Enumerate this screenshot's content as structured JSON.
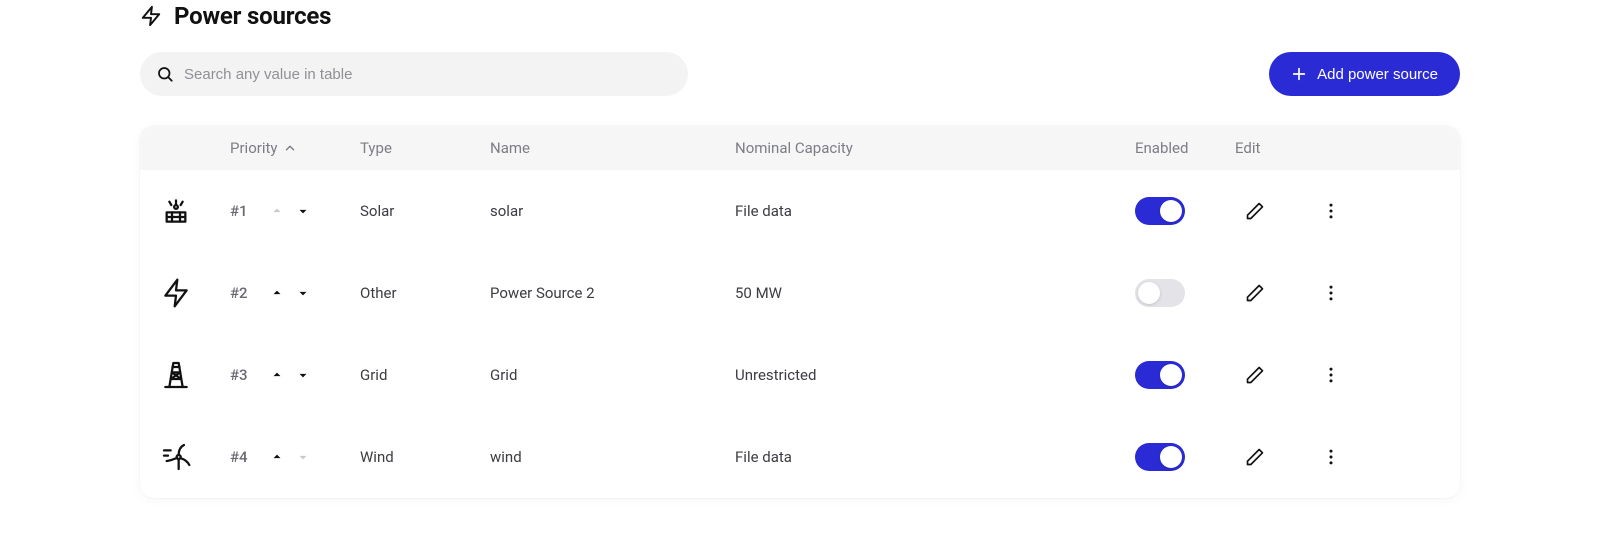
{
  "header": {
    "title": "Power sources"
  },
  "toolbar": {
    "search_placeholder": "Search any value in table",
    "add_button_label": "Add power source"
  },
  "table": {
    "headers": {
      "priority": "Priority",
      "type": "Type",
      "name": "Name",
      "capacity": "Nominal Capacity",
      "enabled": "Enabled",
      "edit": "Edit"
    },
    "rows": [
      {
        "icon": "solar-icon",
        "priority": "#1",
        "up_enabled": false,
        "down_enabled": true,
        "type": "Solar",
        "name": "solar",
        "capacity": "File data",
        "enabled": true
      },
      {
        "icon": "bolt-icon",
        "priority": "#2",
        "up_enabled": true,
        "down_enabled": true,
        "type": "Other",
        "name": "Power Source 2",
        "capacity": "50 MW",
        "enabled": false
      },
      {
        "icon": "grid-icon",
        "priority": "#3",
        "up_enabled": true,
        "down_enabled": true,
        "type": "Grid",
        "name": "Grid",
        "capacity": "Unrestricted",
        "enabled": true
      },
      {
        "icon": "wind-icon",
        "priority": "#4",
        "up_enabled": true,
        "down_enabled": false,
        "type": "Wind",
        "name": "wind",
        "capacity": "File data",
        "enabled": true
      }
    ]
  }
}
